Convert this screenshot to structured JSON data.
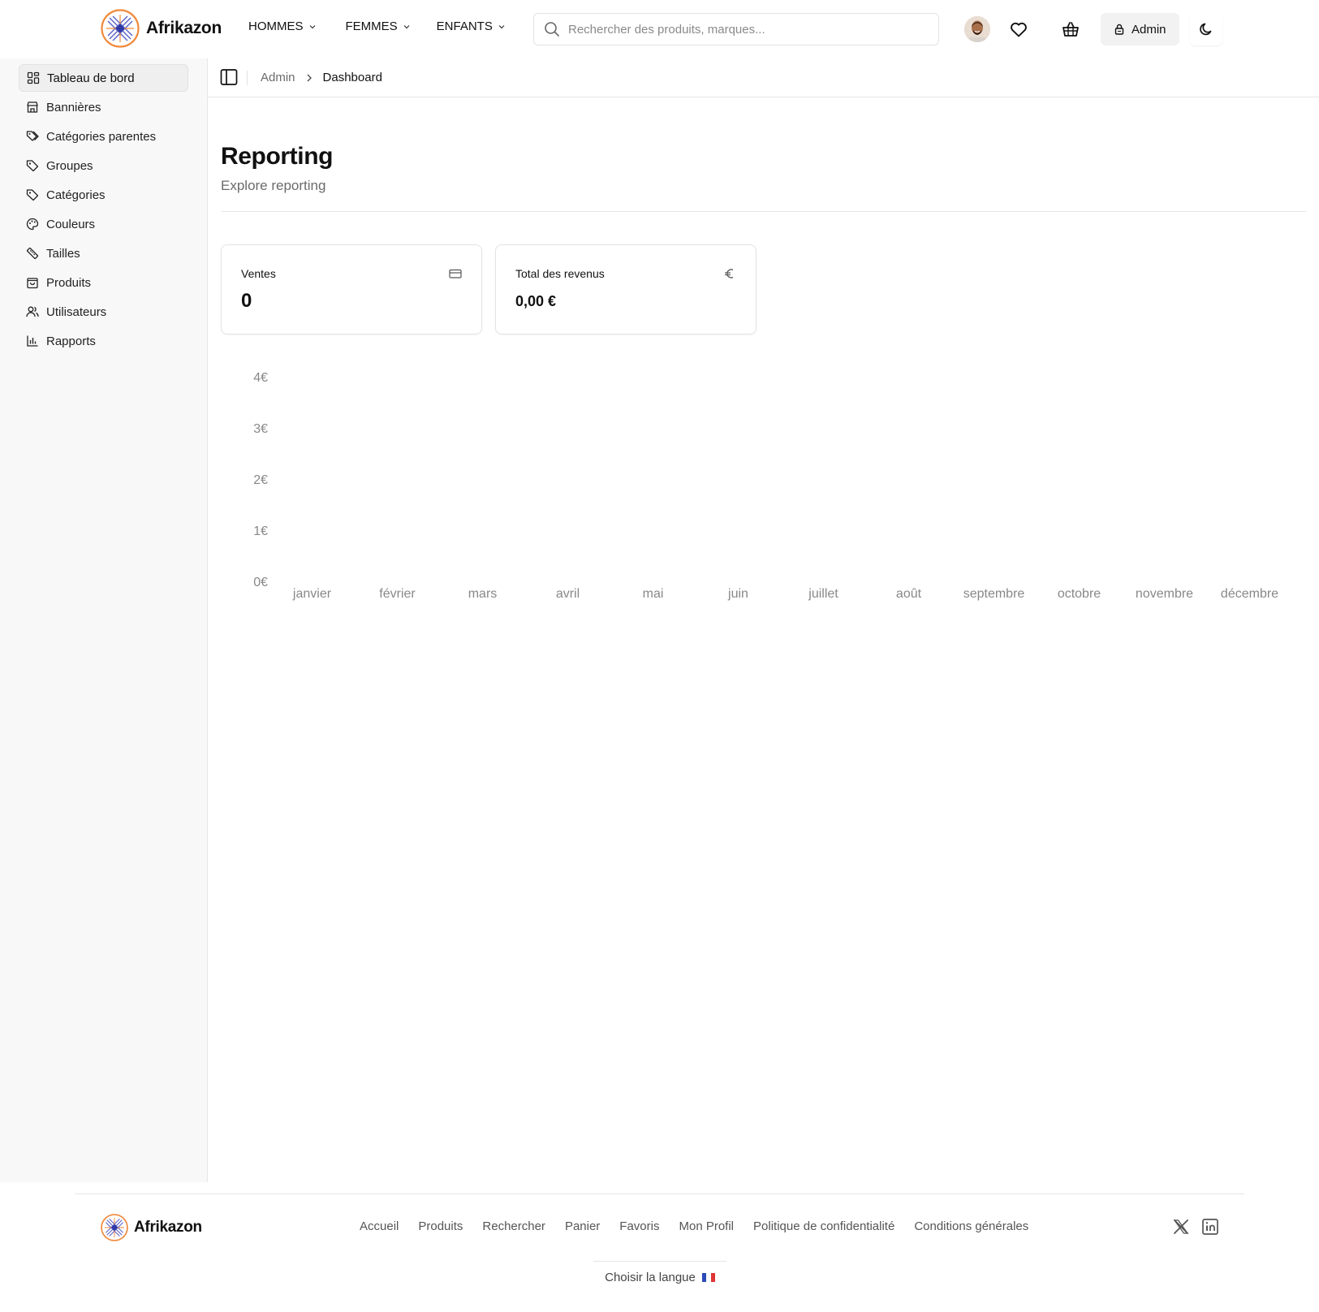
{
  "header": {
    "brand": "Afrikazon",
    "nav": [
      {
        "label": "HOMMES"
      },
      {
        "label": "FEMMES"
      },
      {
        "label": "ENFANTS"
      }
    ],
    "search_placeholder": "Rechercher des produits, marques...",
    "admin_label": "Admin",
    "icons": [
      "search-icon",
      "heart-icon",
      "basket-icon",
      "lock-icon",
      "moon-icon"
    ]
  },
  "sidebar": {
    "items": [
      {
        "label": "Tableau de bord",
        "icon": "dashboard-icon",
        "active": true
      },
      {
        "label": "Bannières",
        "icon": "store-icon"
      },
      {
        "label": "Catégories parentes",
        "icon": "tags-icon"
      },
      {
        "label": "Groupes",
        "icon": "tag-icon"
      },
      {
        "label": "Catégories",
        "icon": "tag-icon"
      },
      {
        "label": "Couleurs",
        "icon": "palette-icon"
      },
      {
        "label": "Tailles",
        "icon": "ruler-icon"
      },
      {
        "label": "Produits",
        "icon": "shopping-bag-icon"
      },
      {
        "label": "Utilisateurs",
        "icon": "users-icon"
      },
      {
        "label": "Rapports",
        "icon": "bar-chart-icon"
      }
    ]
  },
  "breadcrumb": {
    "parent": "Admin",
    "current": "Dashboard"
  },
  "page": {
    "title": "Reporting",
    "subtitle": "Explore reporting"
  },
  "cards": {
    "sales": {
      "label": "Ventes",
      "value": "0",
      "icon": "credit-card-icon"
    },
    "revenue": {
      "label": "Total des revenus",
      "value": "0,00 €",
      "icon": "euro-icon"
    }
  },
  "chart_data": {
    "type": "bar",
    "categories": [
      "janvier",
      "février",
      "mars",
      "avril",
      "mai",
      "juin",
      "juillet",
      "août",
      "septembre",
      "octobre",
      "novembre",
      "décembre"
    ],
    "values": [
      0,
      0,
      0,
      0,
      0,
      0,
      0,
      0,
      0,
      0,
      0,
      0
    ],
    "y_ticks": [
      "0€",
      "1€",
      "2€",
      "3€",
      "4€"
    ],
    "ylim": [
      0,
      4
    ],
    "grid": false,
    "title": "",
    "xlabel": "",
    "ylabel": ""
  },
  "footer": {
    "brand": "Afrikazon",
    "links": [
      "Accueil",
      "Produits",
      "Rechercher",
      "Panier",
      "Favoris",
      "Mon Profil",
      "Politique de confidentialité",
      "Conditions générales"
    ],
    "social": [
      "x-icon",
      "linkedin-icon"
    ],
    "language_label": "Choisir la langue"
  }
}
